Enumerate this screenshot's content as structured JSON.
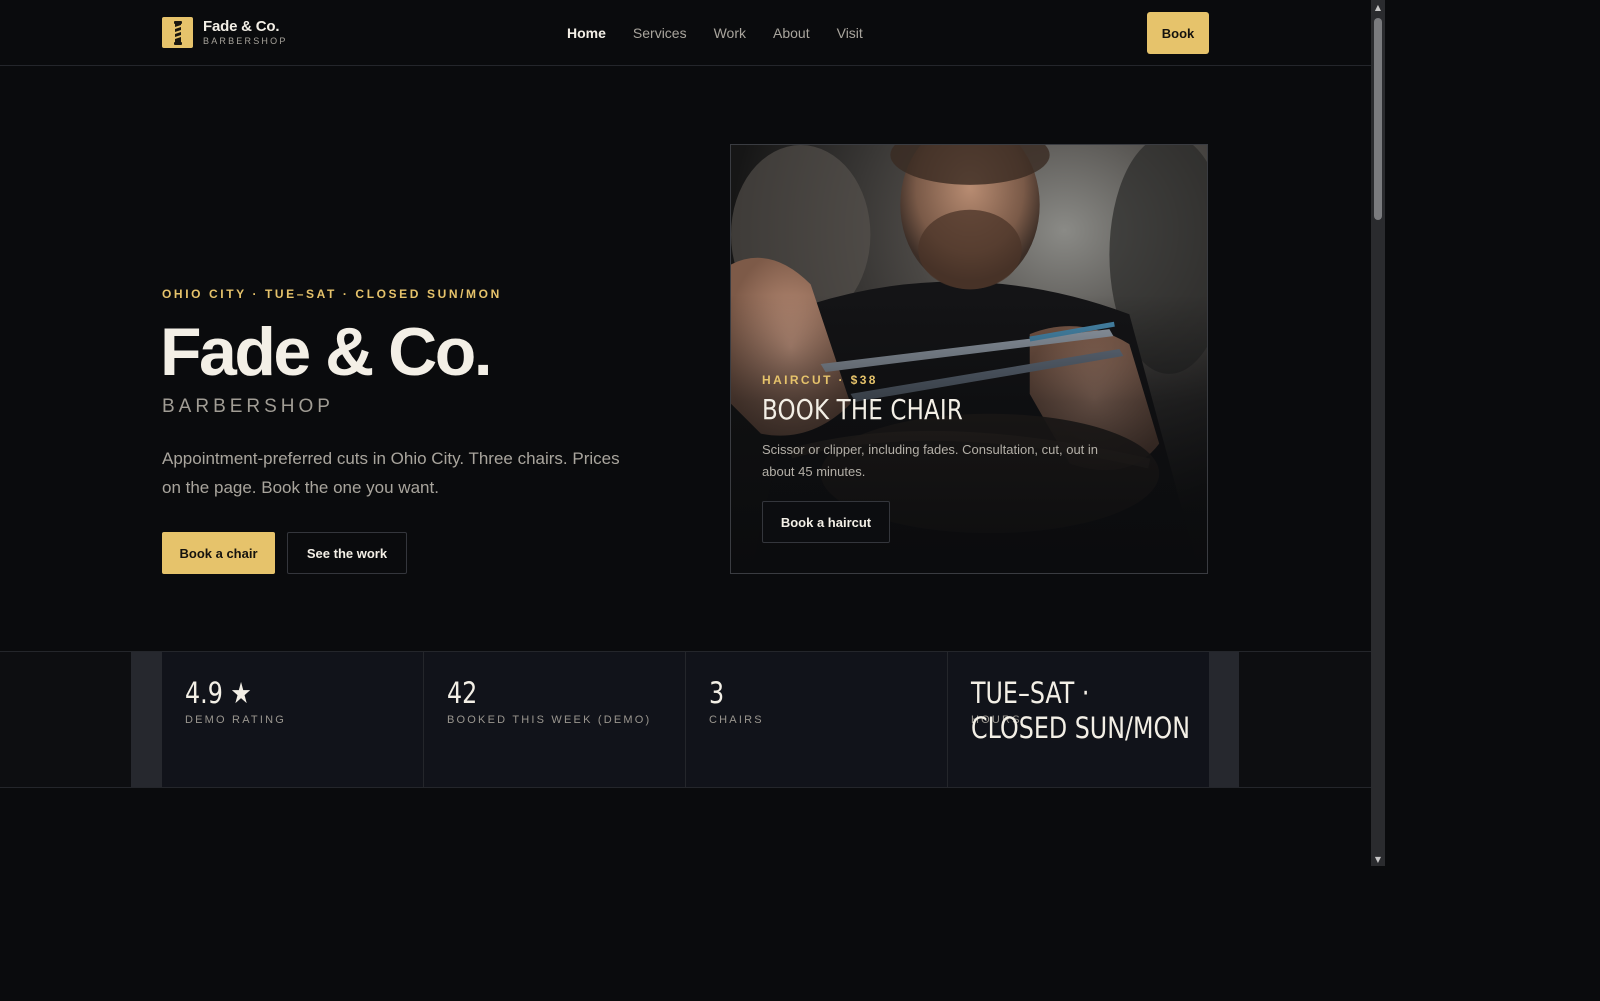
{
  "header": {
    "brand_name": "Fade & Co.",
    "brand_sub": "BARBERSHOP",
    "nav": [
      {
        "label": "Home",
        "active": true
      },
      {
        "label": "Services",
        "active": false
      },
      {
        "label": "Work",
        "active": false
      },
      {
        "label": "About",
        "active": false
      },
      {
        "label": "Visit",
        "active": false
      }
    ],
    "book_label": "Book"
  },
  "hero": {
    "eyebrow": "OHIO CITY · TUE–SAT · CLOSED SUN/MON",
    "title": "Fade & Co.",
    "subtitle": "BARBERSHOP",
    "description": "Appointment-preferred cuts in Ohio City. Three chairs. Prices on the page. Book the one you want.",
    "primary_label": "Book a chair",
    "secondary_label": "See the work"
  },
  "card": {
    "eyebrow": "HAIRCUT · $38",
    "title": "BOOK THE CHAIR",
    "description": "Scissor or clipper, including fades. Consultation, cut, out in about 45 minutes.",
    "button_label": "Book a haircut"
  },
  "stats": [
    {
      "value": "4.9 ★",
      "label": "DEMO RATING"
    },
    {
      "value": "42",
      "label": "BOOKED THIS WEEK (DEMO)"
    },
    {
      "value": "3",
      "label": "CHAIRS"
    },
    {
      "value": "TUE–SAT · CLOSED SUN/MON",
      "label": "HOURS"
    }
  ],
  "colors": {
    "background": "#0a0b0d",
    "accent": "#e6c36b",
    "text": "#f3efe6",
    "muted": "#a9a59d"
  },
  "icons": {
    "brand": "barber-pole-icon",
    "scroll_up": "chevron-up-icon",
    "scroll_down": "chevron-down-icon"
  }
}
